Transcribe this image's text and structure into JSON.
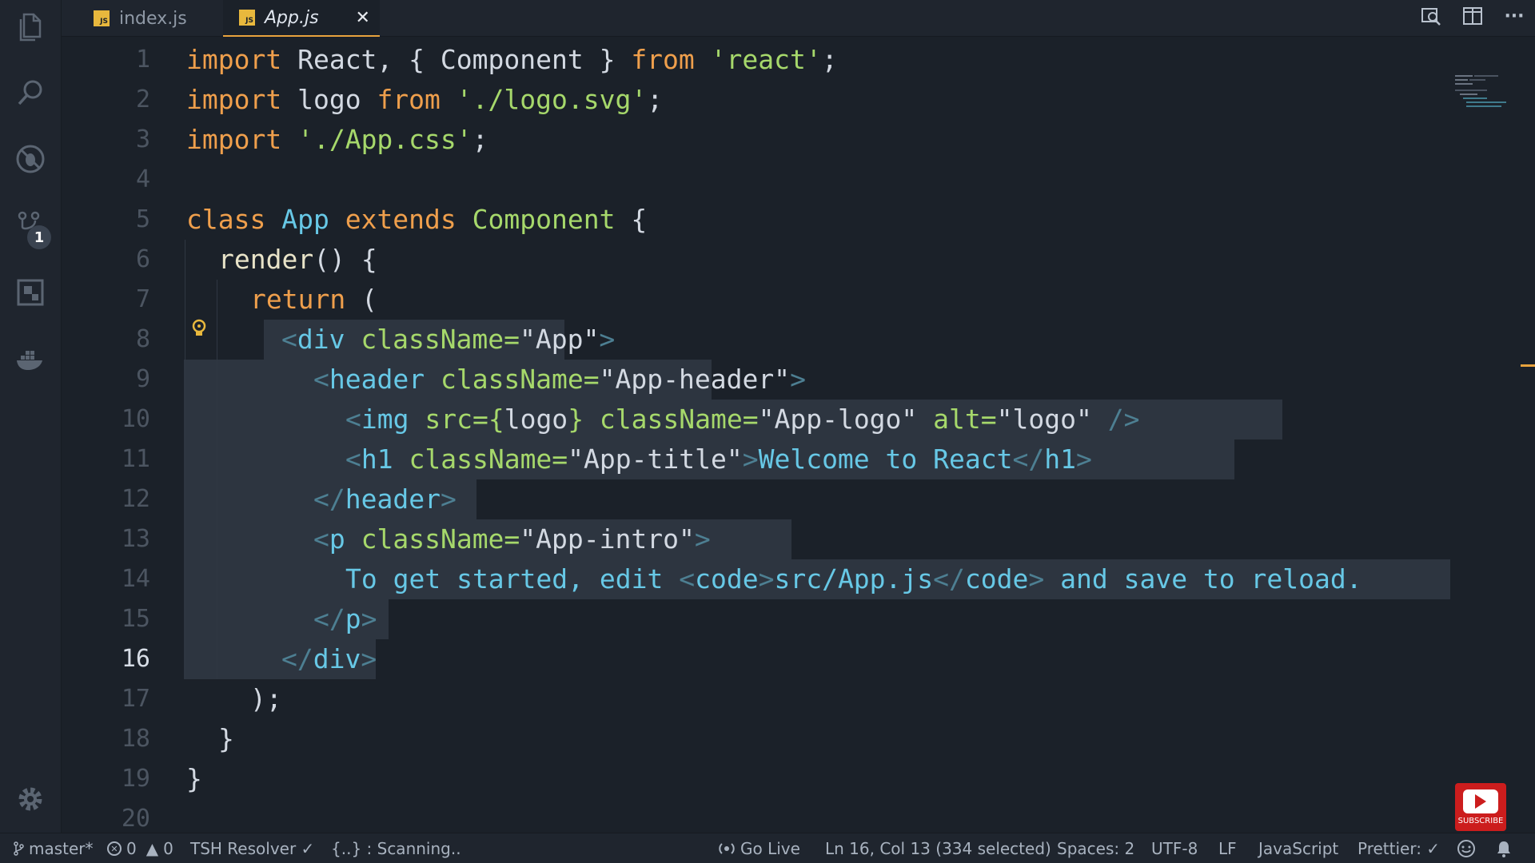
{
  "tabs": [
    {
      "label": "index.js",
      "icon": "js-file-icon",
      "active": false
    },
    {
      "label": "App.js",
      "icon": "js-file-icon",
      "active": true
    }
  ],
  "activity_badge": "1",
  "editor": {
    "current_line": 16,
    "lines": [
      {
        "n": "1"
      },
      {
        "n": "2"
      },
      {
        "n": "3"
      },
      {
        "n": "4"
      },
      {
        "n": "5"
      },
      {
        "n": "6"
      },
      {
        "n": "7"
      },
      {
        "n": "8"
      },
      {
        "n": "9"
      },
      {
        "n": "10"
      },
      {
        "n": "11"
      },
      {
        "n": "12"
      },
      {
        "n": "13"
      },
      {
        "n": "14"
      },
      {
        "n": "15"
      },
      {
        "n": "16"
      },
      {
        "n": "17"
      },
      {
        "n": "18"
      },
      {
        "n": "19"
      },
      {
        "n": "20"
      }
    ],
    "tokens": {
      "l1": [
        "import",
        " React, { Component } ",
        "from",
        " ",
        "'react'",
        ";"
      ],
      "l2": [
        "import",
        " logo ",
        "from",
        " ",
        "'./logo.svg'",
        ";"
      ],
      "l3": [
        "import",
        " ",
        "'./App.css'",
        ";"
      ],
      "l5": [
        "class",
        " ",
        "App",
        " ",
        "extends",
        " ",
        "Component",
        " {"
      ],
      "l6": [
        "render",
        "() {"
      ],
      "l7": [
        "return",
        " ("
      ],
      "l8": [
        "<",
        "div",
        " className=",
        "\"App\"",
        ">"
      ],
      "l9": [
        "<",
        "header",
        " className=",
        "\"App-header\"",
        ">"
      ],
      "l10": [
        "<",
        "img",
        " src={",
        "logo",
        "} className=",
        "\"App-logo\"",
        " alt=",
        "\"logo\"",
        " />"
      ],
      "l11": [
        "<",
        "h1",
        " className=",
        "\"App-title\"",
        ">",
        "Welcome to React",
        "</",
        "h1",
        ">"
      ],
      "l12": [
        "</",
        "header",
        ">"
      ],
      "l13": [
        "<",
        "p",
        " className=",
        "\"App-intro\"",
        ">"
      ],
      "l14": [
        "To get started, edit ",
        "<",
        "code",
        ">",
        "src/App.js",
        "</",
        "code",
        ">",
        " and save to reload."
      ],
      "l15": [
        "</",
        "p",
        ">"
      ],
      "l16": [
        "</",
        "div",
        ">"
      ],
      "l17": [
        ");"
      ],
      "l18": [
        "}"
      ],
      "l19": [
        "}"
      ]
    }
  },
  "statusbar": {
    "branch": "master*",
    "errors": "0",
    "warnings": "0",
    "resolver": "TSH Resolver ✓",
    "scanning": "{..} : Scanning..",
    "go_live": "Go Live",
    "position": "Ln 16, Col 13 (334 selected)",
    "spaces": "Spaces: 2",
    "encoding": "UTF-8",
    "eol": "LF",
    "language": "JavaScript",
    "prettier": "Prettier: ✓"
  },
  "subscribe_label": "SUBSCRIBE",
  "colors": {
    "background": "#1b2129",
    "keyword": "#ef9f4c",
    "string": "#a6d86b",
    "tag": "#67c8e6",
    "selection": "#2d3540"
  }
}
